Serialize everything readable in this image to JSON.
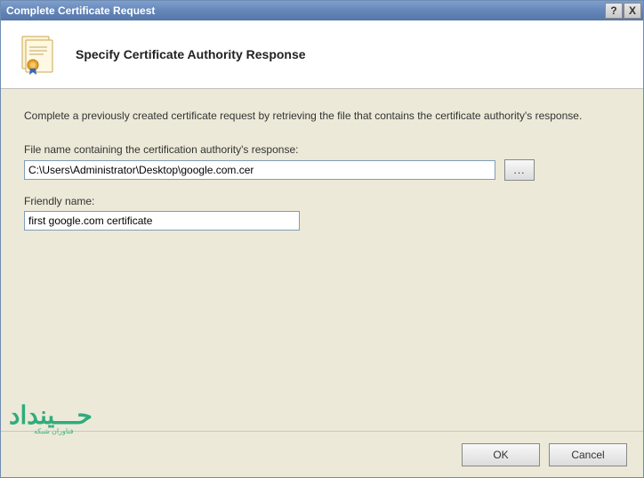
{
  "titlebar": {
    "title": "Complete Certificate Request",
    "help_label": "?",
    "close_label": "X"
  },
  "header": {
    "title": "Specify Certificate Authority Response"
  },
  "content": {
    "description": "Complete a previously created certificate request by retrieving the file that contains the certificate authority's response.",
    "file_label": "File name containing the certification authority's response:",
    "file_value": "C:\\Users\\Administrator\\Desktop\\google.com.cer",
    "browse_label": "...",
    "friendly_label": "Friendly name:",
    "friendly_value": "first google.com certificate"
  },
  "footer": {
    "ok_label": "OK",
    "cancel_label": "Cancel"
  },
  "watermark": {
    "main": "حـــینداد",
    "sub": "فناوران شبکه"
  }
}
